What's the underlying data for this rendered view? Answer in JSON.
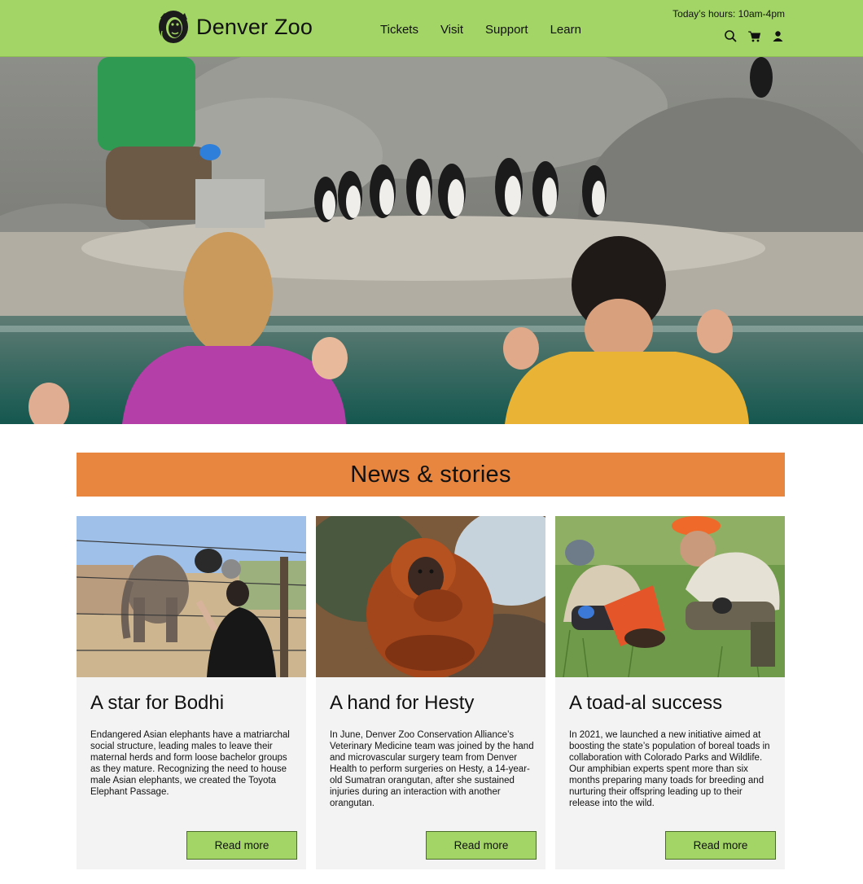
{
  "header": {
    "brand_name": "Denver Zoo",
    "nav": [
      "Tickets",
      "Visit",
      "Support",
      "Learn"
    ],
    "hours": "Today’s hours: 10am-4pm",
    "icons": [
      "search-icon",
      "cart-icon",
      "account-icon"
    ],
    "bg_color": "#a2d565"
  },
  "hero": {
    "image": "penguin-exhibit-photo"
  },
  "news": {
    "heading": "News & stories",
    "banner_color": "#e8853f",
    "cards": [
      {
        "title": "A star for Bodhi",
        "body": "Endangered Asian elephants have a matriarchal social structure, leading males to leave their maternal herds and form loose bachelor groups as they mature. Recognizing the need to house male Asian elephants, we created the Toyota Elephant Passage.",
        "button": "Read more",
        "image": "elephant-photo"
      },
      {
        "title": "A hand for Hesty",
        "body": "In June, Denver Zoo Conservation Alliance’s Veterinary Medicine team was joined by the hand and microvascular surgery team from Denver Health to perform surgeries on Hesty, a 14-year-old Sumatran orangutan, after she sustained injuries during an interaction with another orangutan.",
        "button": "Read more",
        "image": "orangutan-photo"
      },
      {
        "title": "A toad-al success",
        "body": "In 2021, we launched a new initiative aimed at boosting the state’s population of boreal toads in collaboration with Colorado Parks and Wildlife. Our amphibian experts spent more than six months preparing many toads for breeding and nurturing their offspring leading up to their release into the wild.",
        "button": "Read more",
        "image": "toad-release-photo"
      }
    ]
  }
}
